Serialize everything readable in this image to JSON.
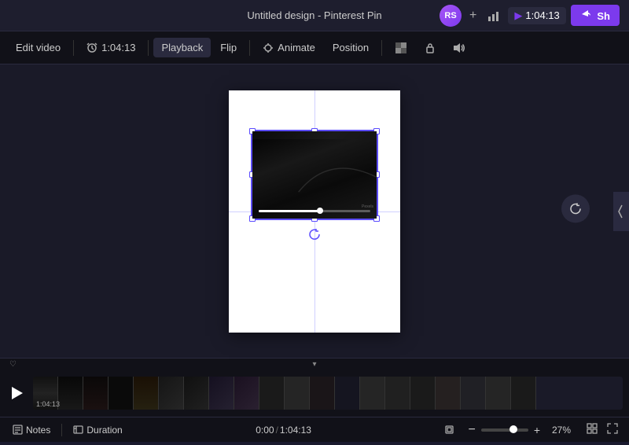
{
  "topbar": {
    "title": "Untitled design - Pinterest Pin",
    "avatar_initials": "RS",
    "timer": "1:04:13",
    "share_label": "Sh",
    "plus_icon": "+",
    "chart_icon": "📊",
    "play_icon": "▶"
  },
  "toolbar": {
    "edit_video_label": "Edit video",
    "timestamp_label": "1:04:13",
    "playback_label": "Playback",
    "flip_label": "Flip",
    "animate_label": "Animate",
    "position_label": "Position",
    "lock_icon": "🔒",
    "transparency_icon": "⬛",
    "volume_icon": "🔊"
  },
  "canvas": {
    "video_playing": false,
    "progress_pct": 55
  },
  "timeline": {
    "play_icon": "▶",
    "time_label": "1:04:13",
    "chevron_label": "▾",
    "heart_icon": "♡"
  },
  "statusbar": {
    "notes_label": "Notes",
    "duration_label": "Duration",
    "time_current": "0:00",
    "time_total": "1:04:13",
    "zoom_pct": "27%",
    "fit_icon": "⊡",
    "grid_icon": "⊞",
    "expand_icon": "⤢",
    "notes_icon": "📝",
    "duration_icon": "🎬"
  }
}
